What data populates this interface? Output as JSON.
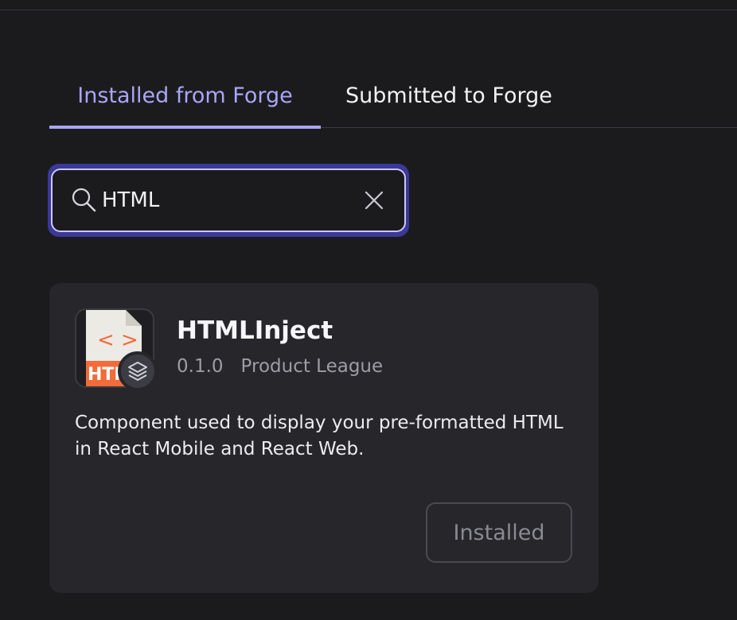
{
  "tabs": {
    "installed_label": "Installed from Forge",
    "submitted_label": "Submitted to Forge"
  },
  "search": {
    "value": "HTML",
    "icon": "search-icon",
    "clear_icon": "close-icon"
  },
  "card": {
    "title": "HTMLInject",
    "version": "0.1.0",
    "publisher": "Product League",
    "description": "Component used to display your pre-formatted HTML in React Mobile and React Web.",
    "button_label": "Installed",
    "icon_text": "HTN",
    "icon_symbol": "< >"
  },
  "colors": {
    "accent": "#a9a6f5",
    "background": "#1b1b1e",
    "card": "#26262b",
    "html_orange": "#f26b3a"
  }
}
